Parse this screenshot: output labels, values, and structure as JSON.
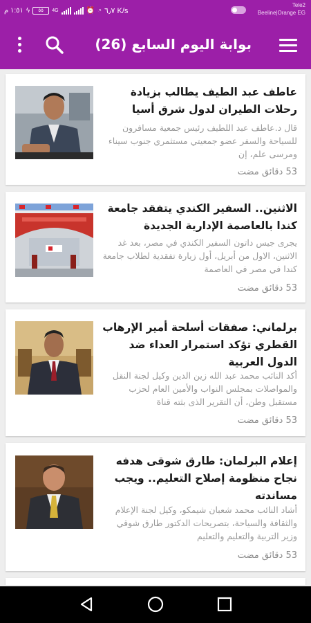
{
  "status_bar": {
    "time": "١:٥١ م",
    "speed": "٦٫٧ K/s",
    "battery": "٥٥",
    "carrier_line1": "Tele2",
    "carrier_line2": "Beeline|Orange EG",
    "network_badge": "4G"
  },
  "app_bar": {
    "title": "بوابة اليوم السابع (26)",
    "menu_icon": "hamburger-icon",
    "search_icon": "search-icon",
    "more_icon": "more-vert-icon",
    "color": "#9c1fa8"
  },
  "articles": [
    {
      "headline": "عاطف عبد الطيف يطالب بزيادة رحلات الطيران لدول شرق أسيا",
      "excerpt": "قال د.عاطف عبد اللطيف رئيس جمعية مسافرون للسياحة والسفر عضو جمعيتي مستثمري جنوب سيناء ومرسى علم، إن",
      "time": "53 دقائق مضت"
    },
    {
      "headline": "الاثنين.. السفير الكندي يتفقد جامعة كندا بالعاصمة الإدارية الجديدة",
      "excerpt": "يجرى جيس داتون السفير الكندي في مصر، بعد غد الاثنين، الاول من أبريل، أول زيارة تفقدية لطلاب جامعة كندا في مصر في العاصمة",
      "time": "53 دقائق مضت"
    },
    {
      "headline": "برلماني: صفقات أسلحة أمير الإرهاب القطري تؤكد استمرار العداء ضد الدول العربية",
      "excerpt": "أكد النائب محمد عبد الله زين الدين وكيل لجنة النقل والمواصلات بمجلس النواب والأمين العام لحزب مستقبل وطن، أن التقرير الذى بثته قناة",
      "time": "53 دقائق مضت"
    },
    {
      "headline": "إعلام البرلمان: طارق شوقى هدفه نجاح منظومة إصلاح التعليم.. ويجب مساندته",
      "excerpt": "أشاد النائب محمد شعبان شيمكو، وكيل لجنة الإعلام والثقافة والسياحة، بتصريحات الدكتور طارق شوقي وزير التربية والتعليم والتعليم",
      "time": "53 دقائق مضت"
    }
  ],
  "nav_bar": {
    "back_icon": "back-triangle-icon",
    "home_icon": "home-circle-icon",
    "recents_icon": "recents-square-icon"
  }
}
